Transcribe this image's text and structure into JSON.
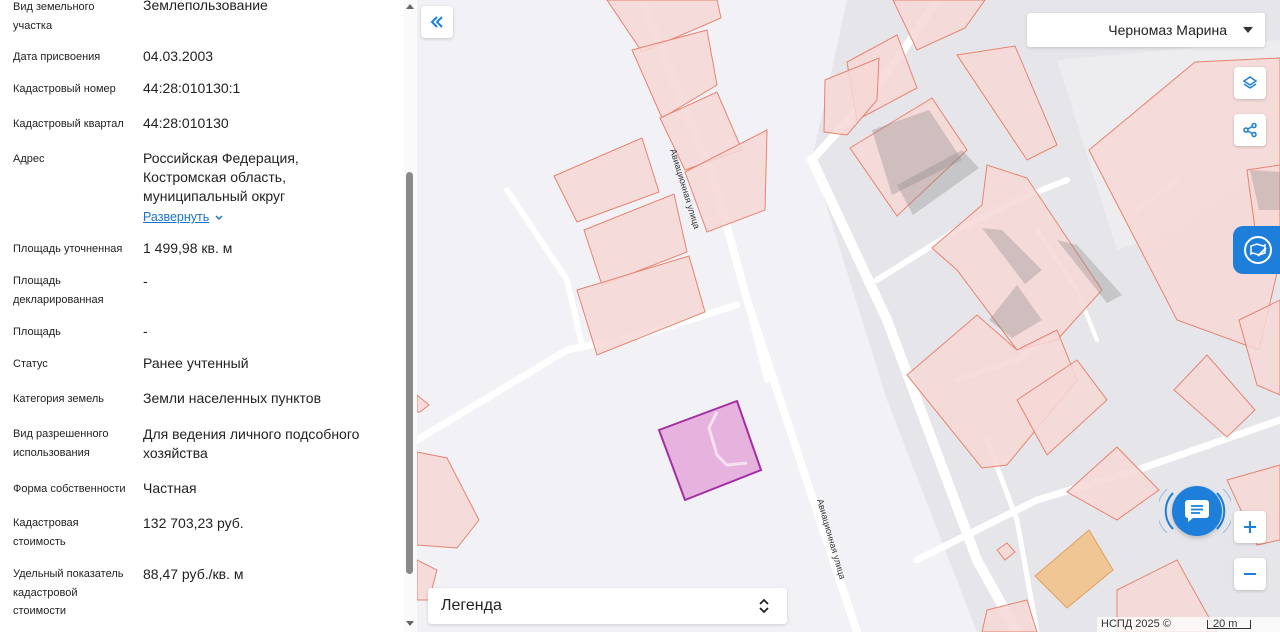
{
  "properties": [
    {
      "label": "Вид земельного участка",
      "value": "Землепользование"
    },
    {
      "label": "Дата присвоения",
      "value": "04.03.2003"
    },
    {
      "label": "Кадастровый номер",
      "value": "44:28:010130:1"
    },
    {
      "label": "Кадастровый квартал",
      "value": "44:28:010130"
    },
    {
      "label": "Адрес",
      "value": "Российская Федерация, Костромская область, муниципальный округ",
      "expand_label": "Развернуть"
    },
    {
      "label": "Площадь уточненная",
      "value": "1 499,98 кв. м"
    },
    {
      "label": "Площадь декларированная",
      "value": "-"
    },
    {
      "label": "Площадь",
      "value": "-"
    },
    {
      "label": "Статус",
      "value": "Ранее учтенный"
    },
    {
      "label": "Категория земель",
      "value": "Земли населенных пунктов"
    },
    {
      "label": "Вид разрешенного использования",
      "value": "Для ведения личного подсобного хозяйства"
    },
    {
      "label": "Форма собственности",
      "value": "Частная"
    },
    {
      "label": "Кадастровая стоимость",
      "value": "132 703,23 руб."
    },
    {
      "label": "Удельный показатель кадастровой стоимости",
      "value": "88,47 руб./кв. м"
    }
  ],
  "map": {
    "user_name": "Черномаз Марина",
    "street_name": "Авиационная улица",
    "legend_label": "Легенда",
    "attribution": "НСПД 2025 ©",
    "scale": "20 m",
    "icons": {
      "collapse": "double-chevron-left-icon",
      "layers": "layers-icon",
      "share": "share-icon",
      "chat": "chat-icon",
      "zoom_in": "plus-icon",
      "zoom_out": "minus-icon"
    },
    "colors": {
      "parcel_fill": "#f6d8d6",
      "parcel_stroke": "#e8836f",
      "selected_fill": "#e6b3de",
      "selected_stroke": "#a42da6",
      "accent": "#1d7fd9"
    }
  }
}
